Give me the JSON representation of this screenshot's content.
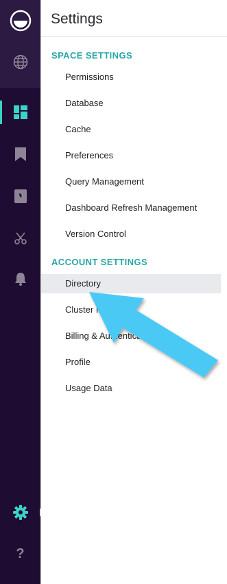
{
  "panel": {
    "title": "Settings",
    "space_section": {
      "label": "SPACE SETTINGS",
      "items": [
        {
          "label": "Permissions"
        },
        {
          "label": "Database"
        },
        {
          "label": "Cache"
        },
        {
          "label": "Preferences"
        },
        {
          "label": "Query Management"
        },
        {
          "label": "Dashboard Refresh Management"
        },
        {
          "label": "Version Control"
        }
      ]
    },
    "account_section": {
      "label": "ACCOUNT SETTINGS",
      "items": [
        {
          "label": "Directory",
          "selected": true
        },
        {
          "label": "Cluster Info"
        },
        {
          "label": "Billing & Authentication"
        },
        {
          "label": "Profile"
        },
        {
          "label": "Usage Data"
        }
      ]
    }
  },
  "sidebar": {
    "icons": [
      "logo-icon",
      "globe-icon",
      "dashboard-icon",
      "bookmark-icon",
      "chat-icon",
      "scissors-icon",
      "bell-icon",
      "gear-icon",
      "help-icon"
    ],
    "active": "dashboard-icon",
    "help_glyph": "?"
  },
  "colors": {
    "rail_bg": "#1f0c33",
    "rail_top_bg": "#2c1a42",
    "accent": "#3bd3c6",
    "section_text": "#2aa7a6",
    "annotation_arrow": "#4cc9f5"
  }
}
